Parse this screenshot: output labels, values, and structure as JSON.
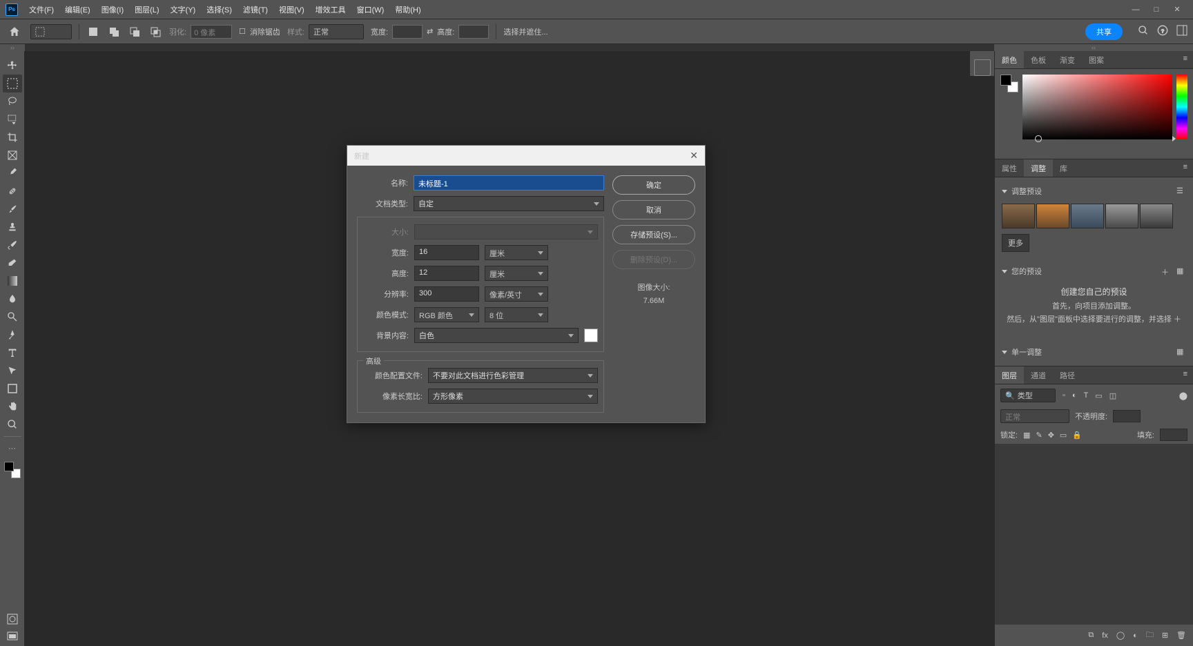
{
  "menubar": {
    "items": [
      "文件(F)",
      "编辑(E)",
      "图像(I)",
      "图层(L)",
      "文字(Y)",
      "选择(S)",
      "滤镜(T)",
      "视图(V)",
      "增效工具",
      "窗口(W)",
      "帮助(H)"
    ]
  },
  "optionsbar": {
    "feather_label": "羽化:",
    "feather_value": "0 像素",
    "antialias": "消除锯齿",
    "style_label": "样式:",
    "style_value": "正常",
    "width_label": "宽度:",
    "height_label": "高度:",
    "mask_label": "选择并遮住...",
    "share": "共享"
  },
  "dialog": {
    "title": "新建",
    "name_label": "名称:",
    "name_value": "未标题-1",
    "doctype_label": "文档类型:",
    "doctype_value": "自定",
    "size_label": "大小:",
    "width_label": "宽度:",
    "width_value": "16",
    "width_unit": "厘米",
    "height_label": "高度:",
    "height_value": "12",
    "height_unit": "厘米",
    "res_label": "分辨率:",
    "res_value": "300",
    "res_unit": "像素/英寸",
    "mode_label": "颜色模式:",
    "mode_value": "RGB 颜色",
    "bits_value": "8 位",
    "bg_label": "背景内容:",
    "bg_value": "白色",
    "advanced": "高级",
    "profile_label": "颜色配置文件:",
    "profile_value": "不要对此文档进行色彩管理",
    "aspect_label": "像素长宽比:",
    "aspect_value": "方形像素",
    "ok": "确定",
    "cancel": "取消",
    "save_preset": "存储预设(S)...",
    "delete_preset": "删除预设(D)...",
    "imgsize_label": "图像大小:",
    "imgsize_value": "7.66M"
  },
  "panels": {
    "color_tabs": [
      "颜色",
      "色板",
      "渐变",
      "图案"
    ],
    "adjust_tabs": [
      "属性",
      "调整",
      "库"
    ],
    "section_preset": "调整预设",
    "more": "更多",
    "section_your": "您的预设",
    "your_line1": "创建您自己的预设",
    "your_line2": "首先，向项目添加调整。",
    "your_line3": "然后，从\"图层\"面板中选择要进行的调整，并选择 ＋",
    "section_single": "单一调整",
    "layer_tabs": [
      "图层",
      "通道",
      "路径"
    ],
    "kind": "类型",
    "blend": "正常",
    "opacity_label": "不透明度:",
    "lock_label": "锁定:",
    "fill_label": "填充:"
  }
}
